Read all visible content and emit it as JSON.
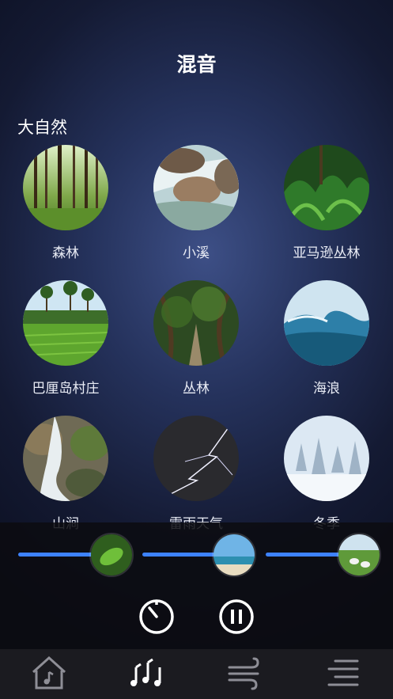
{
  "header": {
    "title": "混音"
  },
  "section": {
    "title": "大自然"
  },
  "sounds": [
    {
      "label": "森林",
      "icon": "forest-image"
    },
    {
      "label": "小溪",
      "icon": "creek-image"
    },
    {
      "label": "亚马逊丛林",
      "icon": "amazon-jungle-image"
    },
    {
      "label": "巴厘岛村庄",
      "icon": "bali-village-image"
    },
    {
      "label": "丛林",
      "icon": "jungle-path-image"
    },
    {
      "label": "海浪",
      "icon": "ocean-wave-image"
    },
    {
      "label": "山涧",
      "icon": "mountain-stream-image"
    },
    {
      "label": "雷雨天气",
      "icon": "thunderstorm-image"
    },
    {
      "label": "冬季",
      "icon": "winter-snow-image"
    }
  ],
  "mixer": {
    "accent": "#3d82ff",
    "channels": [
      {
        "name": "green-leaf-sound",
        "level": 0.68
      },
      {
        "name": "beach-sound",
        "level": 0.68
      },
      {
        "name": "meadow-sheep-sound",
        "level": 0.68
      }
    ],
    "controls": [
      "timer-icon",
      "pause-icon"
    ]
  },
  "tabs": [
    {
      "name": "home-music-icon",
      "active": false
    },
    {
      "name": "mix-notes-icon",
      "active": true
    },
    {
      "name": "wind-icon",
      "active": false
    },
    {
      "name": "menu-icon",
      "active": false
    }
  ]
}
